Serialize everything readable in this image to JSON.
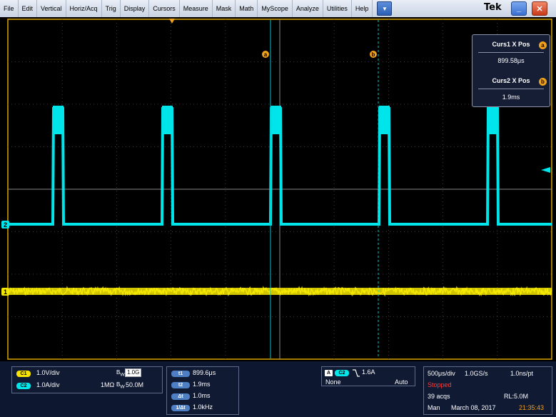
{
  "menubar": {
    "items": [
      "File",
      "Edit",
      "Vertical",
      "Horiz/Acq",
      "Trig",
      "Display",
      "Cursors",
      "Measure",
      "Mask",
      "Math",
      "MyScope",
      "Analyze",
      "Utilities",
      "Help"
    ],
    "brand": "Tek"
  },
  "cursor_readout": {
    "cursor1_label": "Curs1 X Pos",
    "cursor1_value": "899.58μs",
    "cursor1_badge": "a",
    "cursor2_label": "Curs2 X Pos",
    "cursor2_value": "1.9ms",
    "cursor2_badge": "b"
  },
  "graticule": {
    "ch2_marker": "2",
    "ch1_marker": "1",
    "cursor_a_tag": "a",
    "cursor_b_tag": "b",
    "colors": {
      "ch1": "#f5e800",
      "ch2": "#00e5ea",
      "cursor": "#00c8cc",
      "grid": "#4a4a4a",
      "border": "#d9a400"
    }
  },
  "channels": {
    "ch1_chip": "C1",
    "ch1_scale": "1.0V/div",
    "ch1_bw": "1.0G",
    "ch2_chip": "C2",
    "ch2_scale": "1.0A/div",
    "ch2_impedance": "1MΩ",
    "ch2_bw": "50.0M",
    "bw_prefix": "B",
    "bw_sub": "W"
  },
  "cursor_table": {
    "rows": [
      {
        "key": "t1",
        "value": "899.6μs"
      },
      {
        "key": "t2",
        "value": "1.9ms"
      },
      {
        "key": "Δt",
        "value": "1.0ms"
      },
      {
        "key": "1/Δt",
        "value": "1.0kHz"
      }
    ]
  },
  "trigger": {
    "mode_chip": "A",
    "source_chip": "C2",
    "level": "1.6A",
    "coupling": "None",
    "sweep": "Auto"
  },
  "acquisition": {
    "timebase": "500μs/div",
    "sample_rate": "1.0GS/s",
    "resolution": "1.0ns/pt",
    "state": "Stopped",
    "acqs": "39 acqs",
    "record_length": "RL:5.0M",
    "mode": "Man",
    "date": "March 08, 2017",
    "time": "21:35:43"
  }
}
